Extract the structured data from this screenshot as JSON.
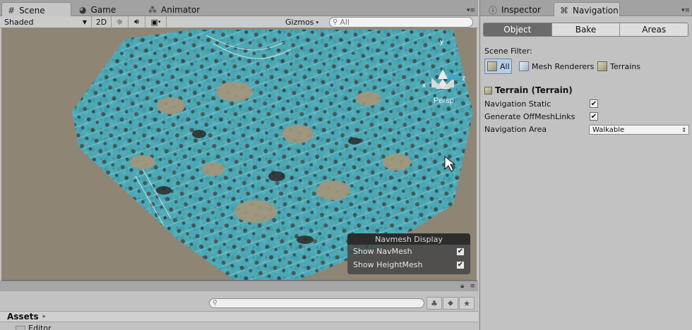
{
  "left_tabs": [
    {
      "label": "Scene",
      "icon": "grid-icon"
    },
    {
      "label": "Game",
      "icon": "pacman-icon"
    },
    {
      "label": "Animator",
      "icon": "animator-icon"
    }
  ],
  "scene_toolbar": {
    "shading_mode": "Shaded",
    "mode_2d": "2D",
    "gizmos_label": "Gizmos",
    "search_placeholder": "All"
  },
  "scene_view": {
    "persp_label": "Persp",
    "gizmo_axes": {
      "y": "y",
      "z": "z",
      "x": "x"
    },
    "navmesh_color": "#3bb3c9",
    "terrain_color": "#958569",
    "background_color": "#8f8574"
  },
  "navmesh_display": {
    "title": "Navmesh Display",
    "options": [
      {
        "label": "Show NavMesh",
        "checked": true
      },
      {
        "label": "Show HeightMesh",
        "checked": true
      }
    ]
  },
  "project": {
    "search_placeholder": "",
    "breadcrumb_root": "Assets",
    "folders": [
      "Editor"
    ]
  },
  "right_tabs": [
    {
      "label": "Inspector",
      "icon": "info-icon"
    },
    {
      "label": "Navigation",
      "icon": "navigation-icon"
    }
  ],
  "navigation": {
    "segments": [
      {
        "label": "Object",
        "active": true
      },
      {
        "label": "Bake",
        "active": false
      },
      {
        "label": "Areas",
        "active": false
      }
    ],
    "scene_filter_label": "Scene Filter:",
    "filters": [
      {
        "label": "All",
        "active": true
      },
      {
        "label": "Mesh Renderers",
        "active": false
      },
      {
        "label": "Terrains",
        "active": false
      }
    ],
    "object_title": "Terrain (Terrain)",
    "properties": [
      {
        "label": "Navigation Static",
        "checked": true
      },
      {
        "label": "Generate OffMeshLinks",
        "checked": true
      }
    ],
    "area_label": "Navigation Area",
    "area_value": "Walkable"
  }
}
